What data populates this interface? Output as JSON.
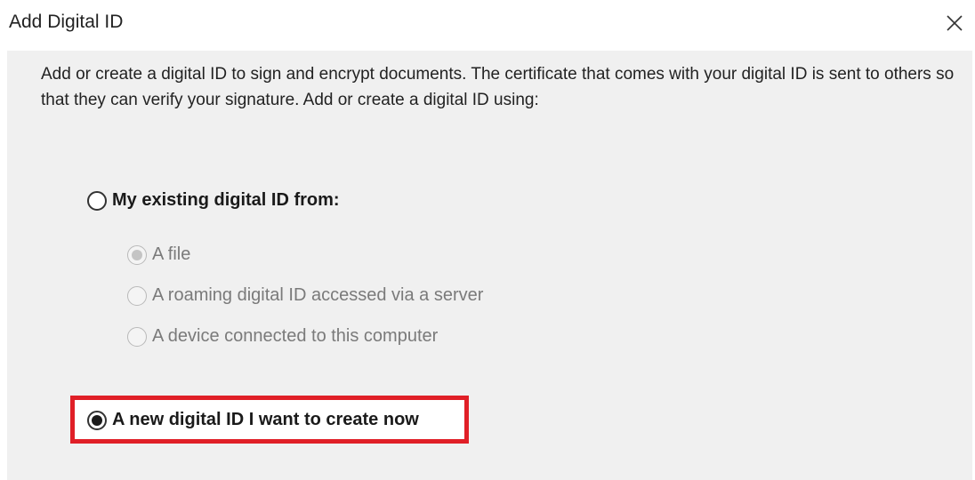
{
  "dialog": {
    "title": "Add Digital ID",
    "close_icon": "close-icon",
    "description": "Add or create a digital ID to sign and encrypt documents. The certificate that comes with your digital ID is sent to others so that they can verify your signature. Add or create a digital ID using:"
  },
  "options": {
    "existing": {
      "label": "My existing digital ID from:",
      "selected": false,
      "enabled": true,
      "sub_options": [
        {
          "label": "A file",
          "selected": true,
          "enabled": false
        },
        {
          "label": "A roaming digital ID accessed via a server",
          "selected": false,
          "enabled": false
        },
        {
          "label": "A device connected to this computer",
          "selected": false,
          "enabled": false
        }
      ]
    },
    "new": {
      "label": "A new digital ID I want to create now",
      "selected": true,
      "enabled": true,
      "highlighted": true
    }
  },
  "colors": {
    "panel_background": "#f0f0f0",
    "highlight_border": "#e01f27",
    "disabled_text": "#7a7a7a"
  }
}
